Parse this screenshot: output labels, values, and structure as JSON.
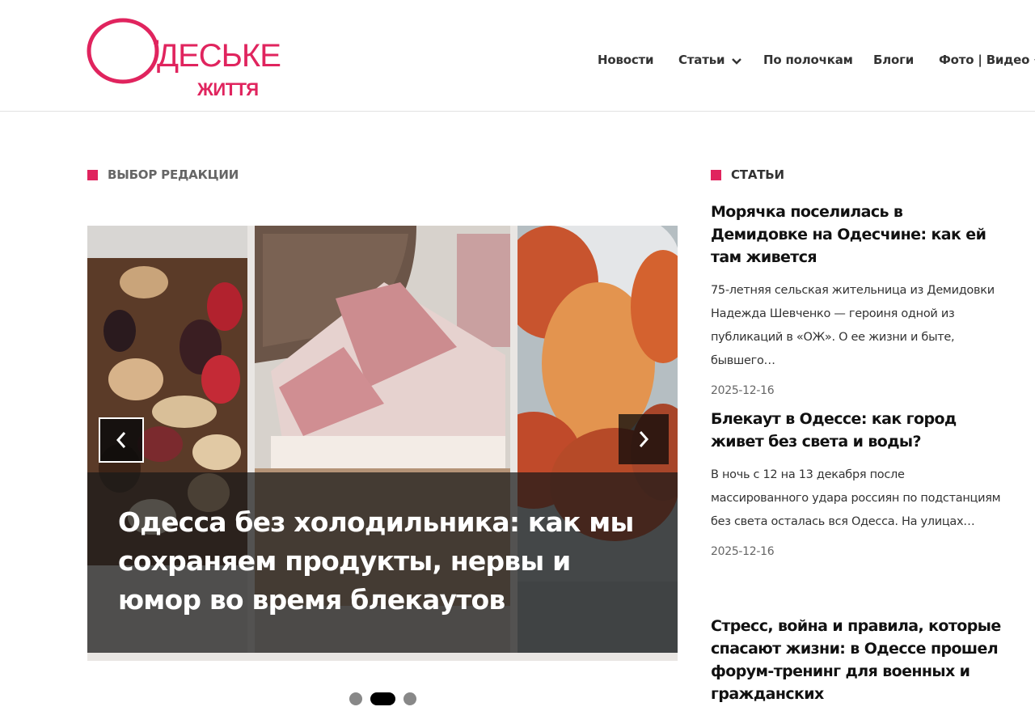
{
  "brand": {
    "name_line1": "ДЕСЬКЕ",
    "name_line2": "ЖИТТЯ",
    "initial": "О",
    "accent_color": "#e0245e"
  },
  "nav": {
    "items": [
      {
        "label": "Новости",
        "has_dropdown": false
      },
      {
        "label": "Статьи",
        "has_dropdown": true
      },
      {
        "label": "По полочкам",
        "has_dropdown": false
      },
      {
        "label": "Блоги",
        "has_dropdown": false
      },
      {
        "label": "Фото | Видео",
        "has_dropdown": true
      }
    ]
  },
  "editor_choice": {
    "heading": "ВЫБОР РЕДАКЦИИ",
    "slide": {
      "title": "Одесса без холодильника: как мы сохраняем продукты, нервы и юмор во время блекаутов"
    },
    "prev_icon": "chevron-left-icon",
    "next_icon": "chevron-right-icon",
    "dots_count": 3,
    "active_dot": 2
  },
  "articles": {
    "heading": "СТАТЬИ",
    "items": [
      {
        "title": "Морячка поселилась в Демидовке на Одесчине: как ей там живется",
        "excerpt": "75-летняя сельская жительница из Демидовки Надежда Шевченко — героиня одной из публикаций в «ОЖ». О ее жизни и быте, бывшего…",
        "date": "2025-12-16"
      },
      {
        "title": "Блекаут в Одессе: как город живет без света и воды?",
        "excerpt": "В ночь с 12 на 13 декабря после массированного удара россиян по подстанциям без света осталась вся Одесса. На улицах…",
        "date": "2025-12-16"
      },
      {
        "title": "Стресс, война и правила, которые спасают жизни: в Одессе прошел форум-тренинг для военных и гражданских"
      }
    ]
  }
}
